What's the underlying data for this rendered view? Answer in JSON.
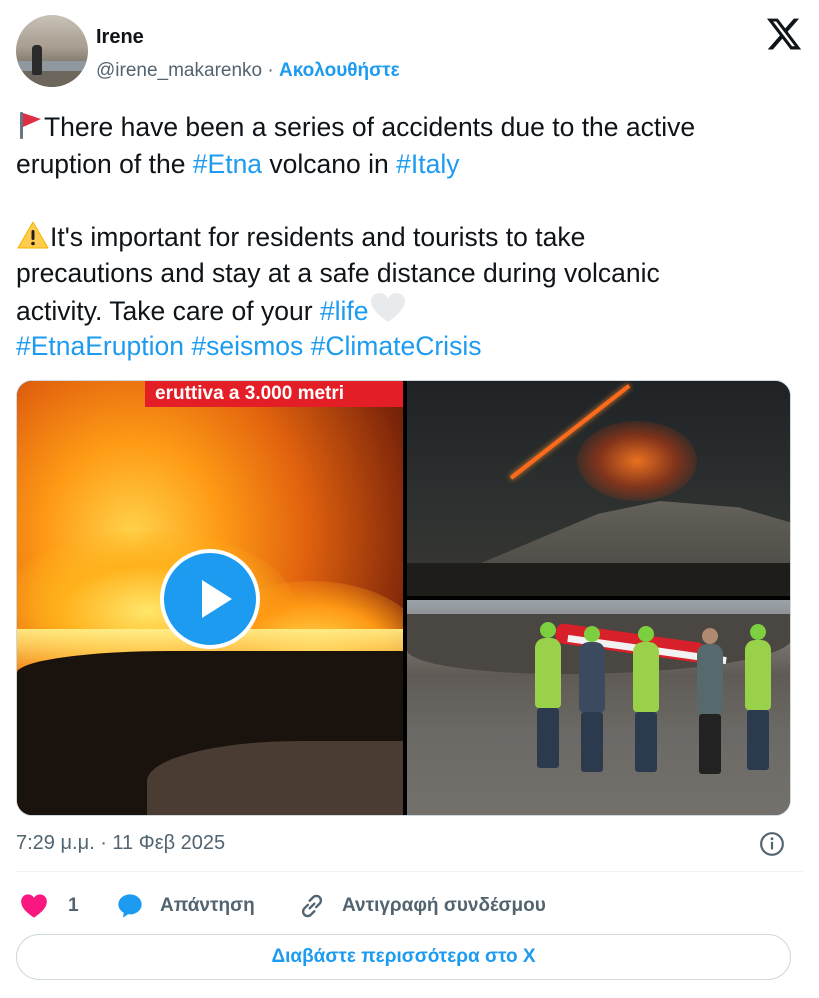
{
  "author": {
    "name": "Irene",
    "handle": "@irene_makarenko",
    "separator": "·",
    "follow_label": "Ακολουθήστε"
  },
  "tweet": {
    "line1_pre": "There have been a series of accidents due to the active",
    "line2_pre": "eruption of the ",
    "tag_etna": "#Etna",
    "line2_mid": " volcano in ",
    "tag_italy": "#Italy",
    "line4": "It's important for residents and tourists to take",
    "line5": "precautions and stay at a safe distance during volcanic",
    "line6_pre": "activity. Take care of your ",
    "tag_life": "#life",
    "tag_etnaeruption": "#EtnaEruption",
    "tag_seismos": "#seismos",
    "tag_climatecrisis": "#ClimateCrisis"
  },
  "media": {
    "video_banner": "eruttiva a 3.000 metri"
  },
  "meta": {
    "timestamp": "7:29 μ.μ. · 11 Φεβ 2025"
  },
  "actions": {
    "like_count": "1",
    "reply_label": "Απάντηση",
    "copy_link_label": "Αντιγραφή συνδέσμου"
  },
  "read_more_label": "Διαβάστε περισσότερα στο X",
  "colors": {
    "accent": "#1d9bf0",
    "like": "#f91880",
    "text": "#0f1419",
    "secondary": "#536471",
    "banner_red": "#e41e26"
  },
  "icons": [
    "x-logo-icon",
    "red-flag-emoji",
    "warning-emoji",
    "white-heart-emoji",
    "play-icon",
    "info-icon",
    "heart-icon",
    "reply-icon",
    "link-icon"
  ]
}
